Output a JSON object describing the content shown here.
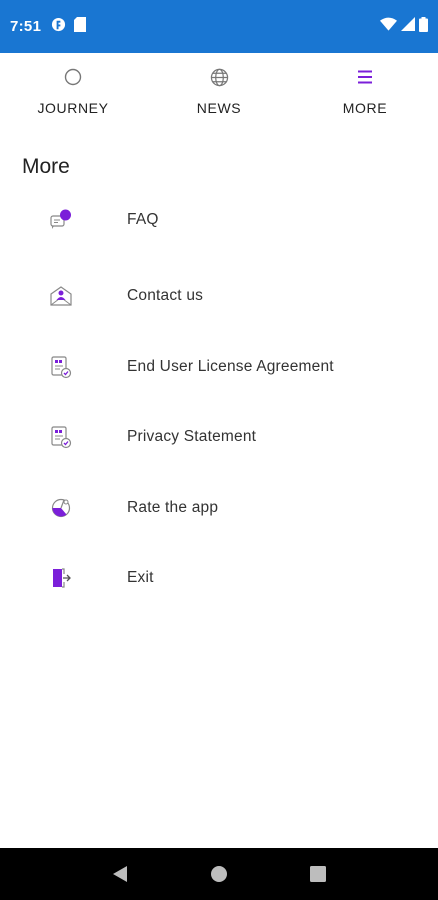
{
  "status_bar": {
    "time": "7:51"
  },
  "tabs": [
    {
      "label": "JOURNEY",
      "icon": "circle-icon",
      "active": false
    },
    {
      "label": "NEWS",
      "icon": "globe-icon",
      "active": false
    },
    {
      "label": "MORE",
      "icon": "menu-icon",
      "active": true
    }
  ],
  "page": {
    "title": "More"
  },
  "menu": {
    "items": [
      {
        "label": "FAQ",
        "icon": "chat-bubbles-icon"
      },
      {
        "label": "Contact us",
        "icon": "envelope-person-icon"
      },
      {
        "label": "End User License Agreement",
        "icon": "document-check-icon"
      },
      {
        "label": "Privacy Statement",
        "icon": "document-check-icon"
      },
      {
        "label": "Rate the app",
        "icon": "rating-icon"
      },
      {
        "label": "Exit",
        "icon": "exit-door-icon"
      }
    ]
  },
  "colors": {
    "accent": "#7b1fd9",
    "status_bar": "#1976d2",
    "nav_bar": "#000000"
  }
}
